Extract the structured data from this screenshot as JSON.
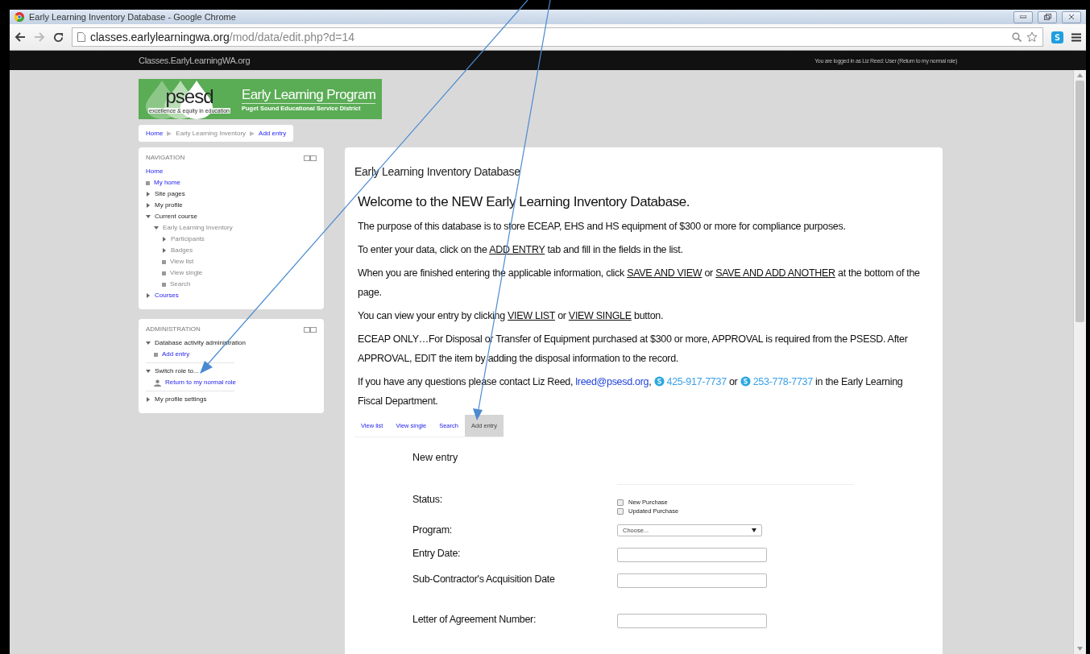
{
  "window": {
    "title": "Early Learning Inventory Database - Google Chrome"
  },
  "browser": {
    "url_host": "classes.earlylearningwa.org",
    "url_path": "/mod/data/edit.php?d=14"
  },
  "site_bar": {
    "site_name": "Classes.EarlyLearningWA.org",
    "login_text": "You are logged in as Liz Reed: User (Return to my normal role)"
  },
  "logo": {
    "brand": "psesd",
    "tagline": "excellence & equity in education",
    "title": "Early Learning Program",
    "subtitle": "Puget Sound Educational Service District"
  },
  "breadcrumb": [
    {
      "label": "Home",
      "link": true
    },
    {
      "label": "Early Learning Inventory",
      "link": false
    },
    {
      "label": "Add entry",
      "link": true
    }
  ],
  "navigation": {
    "title": "NAVIGATION",
    "items": [
      {
        "label": "Home",
        "kind": "none",
        "link": true,
        "dimmed": false
      },
      {
        "label": "My home",
        "kind": "leaf",
        "link": true,
        "dimmed": false
      },
      {
        "label": "Site pages",
        "kind": "branch",
        "expanded": false,
        "link": false,
        "dimmed": false
      },
      {
        "label": "My profile",
        "kind": "branch",
        "expanded": false,
        "link": false,
        "dimmed": false
      },
      {
        "label": "Current course",
        "kind": "branch",
        "expanded": true,
        "link": false,
        "dimmed": false,
        "children": [
          {
            "label": "Early Learning Inventory",
            "kind": "branch",
            "expanded": true,
            "link": false,
            "dimmed": true,
            "children": [
              {
                "label": "Participants",
                "kind": "branch",
                "expanded": false,
                "link": false,
                "dimmed": true
              },
              {
                "label": "Badges",
                "kind": "branch",
                "expanded": false,
                "link": false,
                "dimmed": true
              },
              {
                "label": "View list",
                "kind": "leaf",
                "link": false,
                "dimmed": true
              },
              {
                "label": "View single",
                "kind": "leaf",
                "link": false,
                "dimmed": true
              },
              {
                "label": "Search",
                "kind": "leaf",
                "link": false,
                "dimmed": true
              }
            ]
          }
        ]
      },
      {
        "label": "Courses",
        "kind": "branch",
        "expanded": false,
        "link": true,
        "dimmed": false
      }
    ]
  },
  "administration": {
    "title": "ADMINISTRATION",
    "groups": [
      {
        "label": "Database activity administration",
        "kind": "branch",
        "expanded": true,
        "link": false,
        "dimmed": false,
        "children": [
          {
            "label": "Add entry",
            "kind": "leaf",
            "link": true,
            "dimmed": false
          }
        ]
      },
      {
        "label": "Switch role to...",
        "kind": "branch",
        "expanded": true,
        "link": false,
        "dimmed": false,
        "children": [
          {
            "label": "Return to my normal role",
            "kind": "user",
            "link": true,
            "dimmed": false
          }
        ]
      },
      {
        "label": "My profile settings",
        "kind": "branch",
        "expanded": false,
        "link": false,
        "dimmed": false
      }
    ]
  },
  "main": {
    "heading": "Early Learning Inventory Database",
    "welcome": "Welcome to the NEW Early Learning Inventory Database.",
    "paragraphs": [
      [
        {
          "kind": "plain",
          "text": "The purpose of this database is to store ECEAP, EHS and HS equipment of $300 or more for compliance purposes."
        }
      ],
      [
        {
          "kind": "plain",
          "text": "To enter your data, click on the "
        },
        {
          "kind": "underline",
          "text": "ADD ENTRY"
        },
        {
          "kind": "plain",
          "text": " tab and fill in the fields in the list."
        }
      ],
      [
        {
          "kind": "plain",
          "text": "When you are finished entering the applicable information, click "
        },
        {
          "kind": "underline",
          "text": "SAVE AND VIEW"
        },
        {
          "kind": "plain",
          "text": " or "
        },
        {
          "kind": "underline",
          "text": "SAVE AND ADD ANOTHER"
        },
        {
          "kind": "plain",
          "text": " at the bottom of the page."
        }
      ],
      [
        {
          "kind": "plain",
          "text": "You can view your entry by clicking "
        },
        {
          "kind": "underline",
          "text": "VIEW LIST"
        },
        {
          "kind": "plain",
          "text": " or "
        },
        {
          "kind": "underline",
          "text": "VIEW SINGLE"
        },
        {
          "kind": "plain",
          "text": " button."
        }
      ],
      [
        {
          "kind": "plain",
          "text": "ECEAP ONLY…For Disposal or Transfer of Equipment purchased at $300 or more, APPROVAL is required from the PSESD.  After APPROVAL, EDIT the item by adding the disposal information to the record."
        }
      ],
      [
        {
          "kind": "plain",
          "text": "If you have any questions please contact Liz Reed, "
        },
        {
          "kind": "email",
          "text": "lreed@psesd.org"
        },
        {
          "kind": "plain",
          "text": ", "
        },
        {
          "kind": "phone",
          "text": "425-917-7737"
        },
        {
          "kind": "plain",
          "text": " or "
        },
        {
          "kind": "phone",
          "text": "253-778-7737"
        },
        {
          "kind": "plain",
          "text": " in the Early Learning Fiscal Department."
        }
      ]
    ]
  },
  "tabs": [
    {
      "label": "View list",
      "selected": false
    },
    {
      "label": "View single",
      "selected": false
    },
    {
      "label": "Search",
      "selected": false
    },
    {
      "label": "Add entry",
      "selected": true
    }
  ],
  "form": {
    "title": "New entry",
    "fields": [
      {
        "label": "Status:",
        "kind": "checkboxes",
        "options": [
          {
            "label": "New Purchase",
            "checked": false
          },
          {
            "label": "Updated Purchase",
            "checked": false
          }
        ]
      },
      {
        "label": "Program:",
        "kind": "select",
        "value": "Choose..."
      },
      {
        "label": "Entry Date:",
        "kind": "text"
      },
      {
        "label": "Sub-Contractor's Acquisition Date",
        "kind": "text"
      },
      {
        "label": "Letter of Agreement Number:",
        "kind": "text"
      }
    ]
  }
}
